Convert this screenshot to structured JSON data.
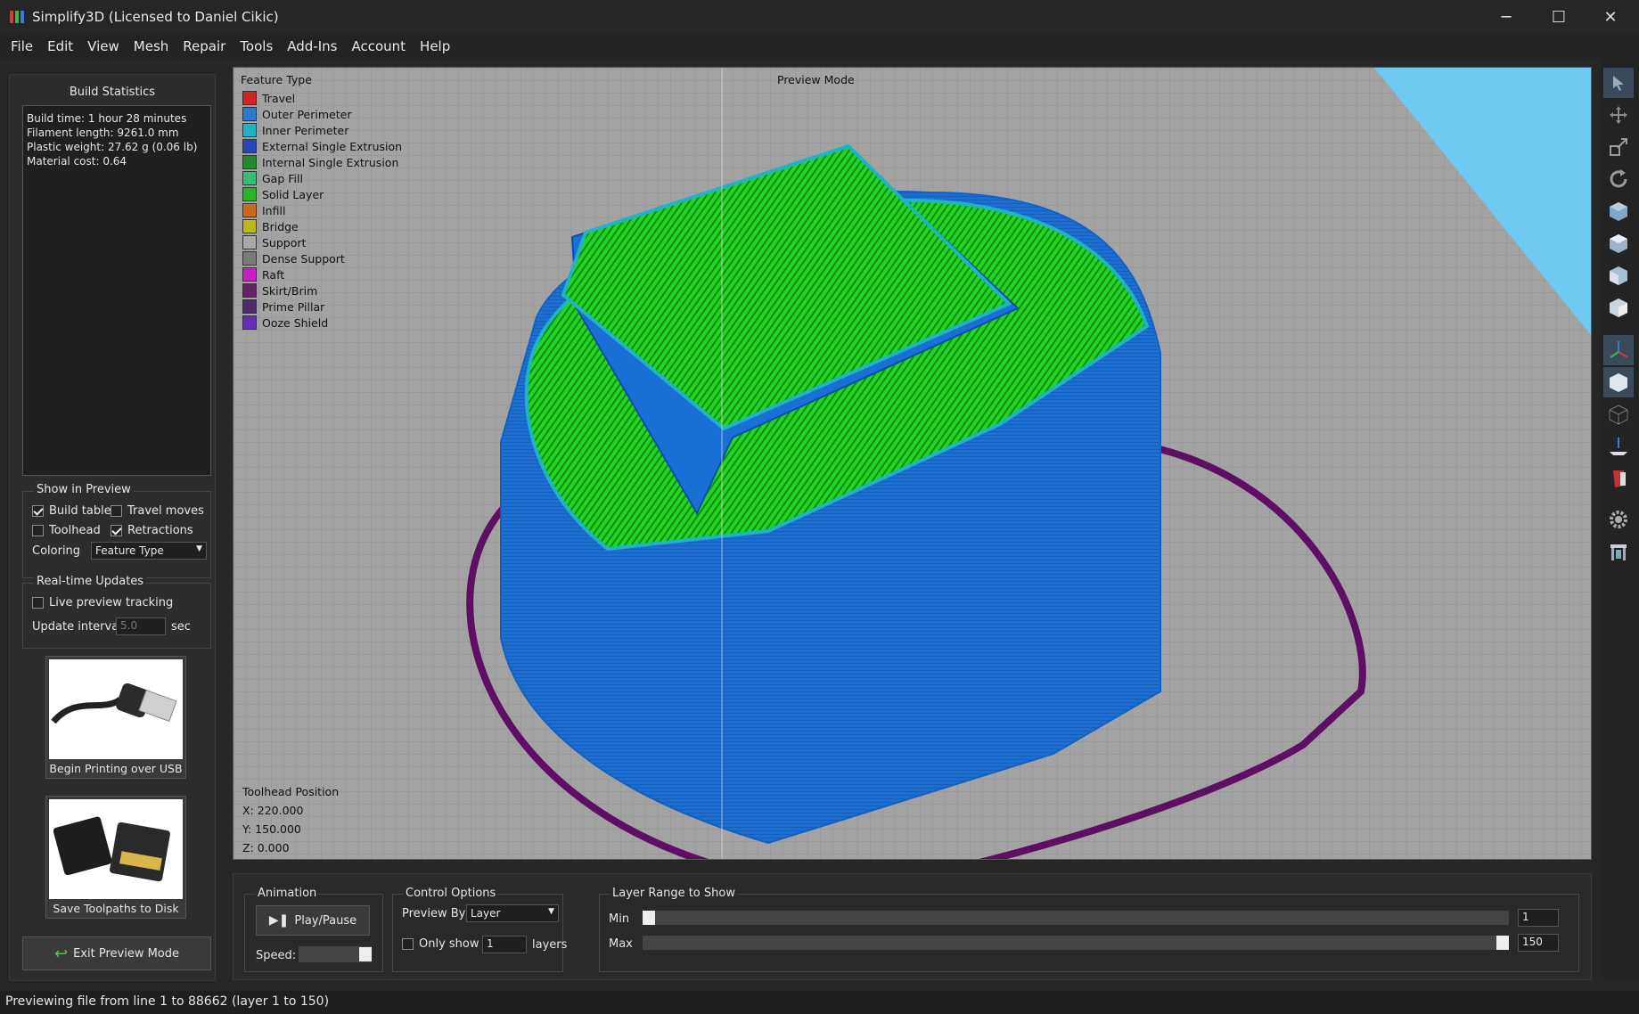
{
  "window": {
    "title": "Simplify3D (Licensed to Daniel Cikic)",
    "minimize_glyph": "─",
    "maximize_glyph": "☐",
    "close_glyph": "✕"
  },
  "menu": [
    "File",
    "Edit",
    "View",
    "Mesh",
    "Repair",
    "Tools",
    "Add-Ins",
    "Account",
    "Help"
  ],
  "build_stats": {
    "title": "Build Statistics",
    "lines": [
      "Build time: 1 hour 28 minutes",
      "Filament length: 9261.0 mm",
      "Plastic weight: 27.62 g (0.06 lb)",
      "Material cost: 0.64"
    ]
  },
  "show_in_preview": {
    "title": "Show in Preview",
    "build_table": {
      "label": "Build table",
      "checked": true
    },
    "travel_moves": {
      "label": "Travel moves",
      "checked": false
    },
    "toolhead": {
      "label": "Toolhead",
      "checked": false
    },
    "retractions": {
      "label": "Retractions",
      "checked": true
    },
    "coloring_label": "Coloring",
    "coloring_value": "Feature Type"
  },
  "realtime": {
    "title": "Real-time Updates",
    "live_preview": {
      "label": "Live preview tracking",
      "checked": false
    },
    "update_interval_label": "Update interval",
    "update_interval_value": "5.0",
    "unit": "sec"
  },
  "buttons": {
    "usb": "Begin Printing over USB",
    "save": "Save Toolpaths to Disk",
    "exit_preview": "Exit Preview Mode"
  },
  "viewport": {
    "legend_title": "Feature Type",
    "mode_label": "Preview Mode",
    "legend": [
      {
        "label": "Travel",
        "color": "#d42121"
      },
      {
        "label": "Outer Perimeter",
        "color": "#2a7bd0"
      },
      {
        "label": "Inner Perimeter",
        "color": "#1fb3c4"
      },
      {
        "label": "External Single Extrusion",
        "color": "#2345b8"
      },
      {
        "label": "Internal Single Extrusion",
        "color": "#1f8c2a"
      },
      {
        "label": "Gap Fill",
        "color": "#3dbb7a"
      },
      {
        "label": "Solid Layer",
        "color": "#26b526"
      },
      {
        "label": "Infill",
        "color": "#cc6a1c"
      },
      {
        "label": "Bridge",
        "color": "#bbb81c"
      },
      {
        "label": "Support",
        "color": "#a8a8a8"
      },
      {
        "label": "Dense Support",
        "color": "#7a7a7a"
      },
      {
        "label": "Raft",
        "color": "#c81fc8"
      },
      {
        "label": "Skirt/Brim",
        "color": "#6a1f6a"
      },
      {
        "label": "Prime Pillar",
        "color": "#4a2a6a"
      },
      {
        "label": "Ooze Shield",
        "color": "#6a2ab8"
      }
    ],
    "toolhead_title": "Toolhead Position",
    "toolhead_x": "X: 220.000",
    "toolhead_y": "Y: 150.000",
    "toolhead_z": "Z: 0.000"
  },
  "toolbar_icons": [
    "select-arrow-icon",
    "move-icon",
    "scale-icon",
    "rotate-icon",
    "cube-view-front-icon",
    "cube-view-top-icon",
    "cube-view-side-icon",
    "cube-view-iso-icon",
    "axes-icon",
    "cube-solid-icon",
    "cube-wireframe-icon",
    "cross-section-icon",
    "red-cube-icon",
    "gear-icon",
    "printer-icon"
  ],
  "animation": {
    "title": "Animation",
    "play_label": "Play/Pause",
    "speed_label": "Speed:",
    "speed_fraction": 1.0
  },
  "control": {
    "title": "Control Options",
    "preview_by_label": "Preview By",
    "preview_by_value": "Layer",
    "only_show_label": "Only show",
    "only_show_value": "1",
    "layers_label": "layers"
  },
  "layer_range": {
    "title": "Layer Range to Show",
    "min_label": "Min",
    "max_label": "Max",
    "min_value": "1",
    "max_value": "150",
    "min_fraction": 0.0,
    "max_fraction": 1.0
  },
  "status": "Previewing file from line 1 to 88662 (layer 1 to 150)"
}
